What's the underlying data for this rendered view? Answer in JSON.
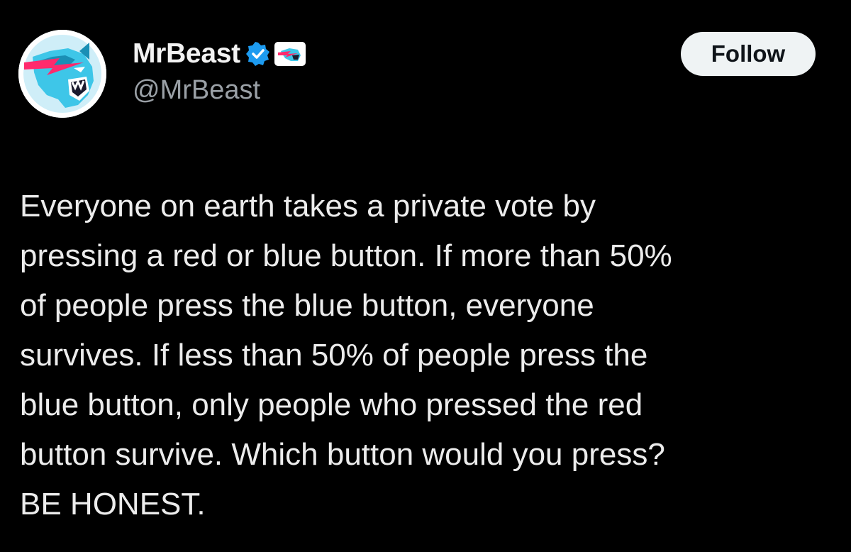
{
  "colors": {
    "background": "#000000",
    "text": "#ececec",
    "handle": "#9aa0a6",
    "follow_bg": "#eff3f4",
    "verified_blue": "#1d9bf0",
    "brand_cyan": "#3ec6e8",
    "brand_pink": "#ff2a6d"
  },
  "author": {
    "display_name": "MrBeast",
    "handle": "@MrBeast",
    "avatar_icon": "panther-logo-icon",
    "verified_icon": "verified-badge-icon",
    "affiliate_icon": "panther-affiliate-badge-icon"
  },
  "actions": {
    "follow_label": "Follow"
  },
  "tweet": {
    "text": "Everyone on earth takes a private vote by\npressing a red or blue button. If more than 50%\nof people press the blue button, everyone\nsurvives. If less than 50% of people press the\nblue button, only people who pressed the red\nbutton survive. Which button would you press?\nBE HONEST."
  }
}
